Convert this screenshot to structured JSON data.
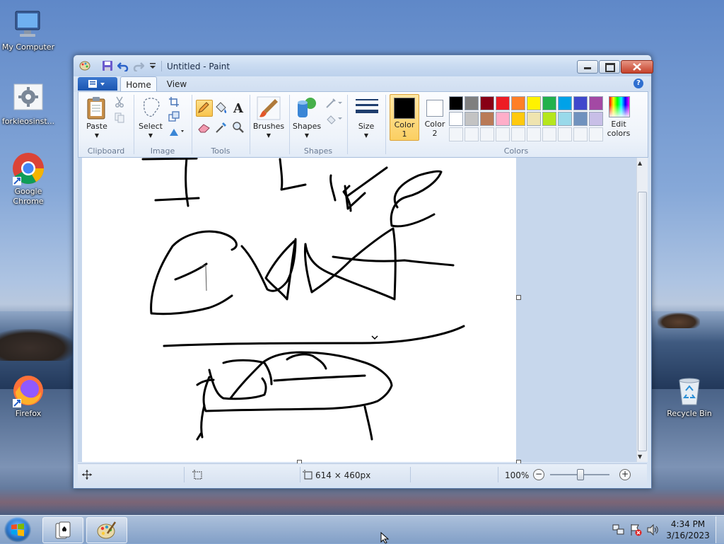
{
  "desktop": {
    "icons": [
      {
        "label": "My Computer"
      },
      {
        "label": "forkieosinst..."
      },
      {
        "label": "Google Chrome"
      },
      {
        "label": "Firefox"
      },
      {
        "label": "Recycle Bin"
      }
    ]
  },
  "window": {
    "title": "Untitled - Paint",
    "tabs": {
      "home": "Home",
      "view": "View"
    },
    "help": "?"
  },
  "ribbon": {
    "clipboard": {
      "paste": "Paste",
      "group": "Clipboard"
    },
    "image": {
      "select": "Select",
      "group": "Image"
    },
    "tools": {
      "group": "Tools"
    },
    "shapes": {
      "brushes": "Brushes",
      "shapes": "Shapes",
      "group": "Shapes"
    },
    "size": {
      "label": "Size"
    },
    "colors": {
      "color1_line1": "Color",
      "color1_line2": "1",
      "color2_line1": "Color",
      "color2_line2": "2",
      "edit_line1": "Edit",
      "edit_line2": "colors",
      "group": "Colors",
      "color1": "#000000",
      "color2": "#ffffff",
      "row1": [
        "#000000",
        "#7f7f7f",
        "#880015",
        "#ed1c24",
        "#ff7f27",
        "#fff200",
        "#22b14c",
        "#00a2e8",
        "#3f48cc",
        "#a349a4"
      ],
      "row2": [
        "#ffffff",
        "#c3c3c3",
        "#b97a57",
        "#ffaec9",
        "#ffc90e",
        "#efe4b0",
        "#b5e61d",
        "#99d9ea",
        "#7092be",
        "#c8bfe7"
      ]
    }
  },
  "status": {
    "dimensions": "614 × 460px",
    "zoom": "100%"
  },
  "taskbar": {
    "time": "4:34 PM",
    "date": "3/16/2023"
  }
}
